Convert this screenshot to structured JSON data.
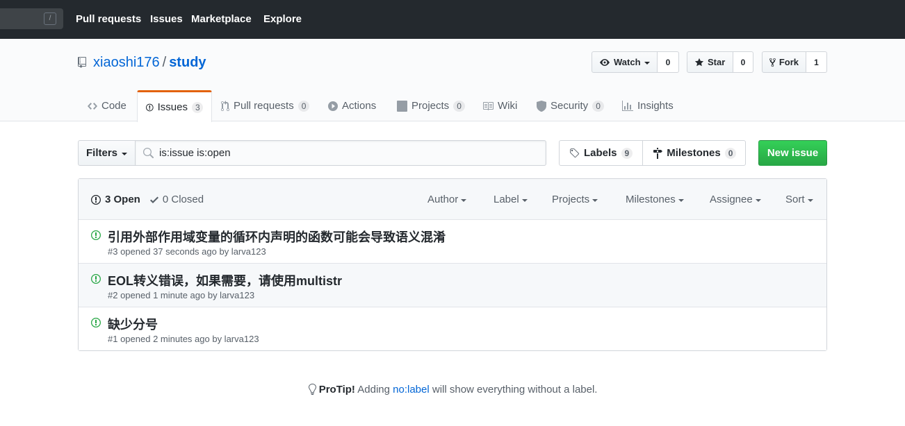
{
  "topnav": {
    "search_hint": "/",
    "items": [
      "Pull requests",
      "Issues",
      "Marketplace",
      "Explore"
    ]
  },
  "repo": {
    "owner": "xiaoshi176",
    "separator": "/",
    "name": "study",
    "watch": {
      "label": "Watch",
      "count": "0"
    },
    "star": {
      "label": "Star",
      "count": "0"
    },
    "fork": {
      "label": "Fork",
      "count": "1"
    }
  },
  "tabs": [
    {
      "label": "Code",
      "icon": "code-icon"
    },
    {
      "label": "Issues",
      "count": "3",
      "icon": "issue-icon",
      "selected": true
    },
    {
      "label": "Pull requests",
      "count": "0",
      "icon": "pull-request-icon"
    },
    {
      "label": "Actions",
      "icon": "play-icon"
    },
    {
      "label": "Projects",
      "count": "0",
      "icon": "project-icon"
    },
    {
      "label": "Wiki",
      "icon": "book-icon"
    },
    {
      "label": "Security",
      "count": "0",
      "icon": "shield-icon"
    },
    {
      "label": "Insights",
      "icon": "graph-icon"
    }
  ],
  "filterbar": {
    "filters_label": "Filters",
    "search_value": "is:issue is:open",
    "labels": {
      "label": "Labels",
      "count": "9"
    },
    "milestones": {
      "label": "Milestones",
      "count": "0"
    },
    "new_issue": "New issue"
  },
  "issue_list": {
    "open_label": "3 Open",
    "closed_label": "0 Closed",
    "filters": [
      "Author",
      "Label",
      "Projects",
      "Milestones",
      "Assignee",
      "Sort"
    ],
    "issues": [
      {
        "title": "引用外部作用域变量的循环内声明的函数可能会导致语义混淆",
        "meta": "#3 opened 37 seconds ago by larva123"
      },
      {
        "title": "EOL转义错误，如果需要，请使用multistr",
        "meta": "#2 opened 1 minute ago by larva123"
      },
      {
        "title": "缺少分号",
        "meta": "#1 opened 2 minutes ago by larva123"
      }
    ]
  },
  "protip": {
    "strong": "ProTip!",
    "before": " Adding ",
    "link": "no:label",
    "after": " will show everything without a label."
  },
  "colors": {
    "header_bg": "#24292e",
    "open_green": "#28a745",
    "link_blue": "#0366d6",
    "tab_accent": "#e36209"
  }
}
